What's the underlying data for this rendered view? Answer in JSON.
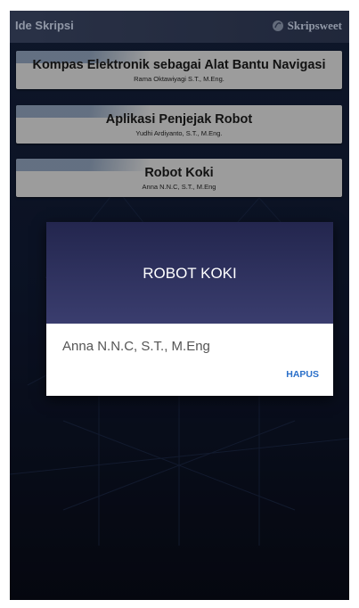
{
  "app_bar": {
    "title": "Ide Skripsi",
    "brand": "Skripsweet",
    "brand_icon": "skripsweet-logo-icon"
  },
  "cards": [
    {
      "title": "Kompas Elektronik sebagai Alat Bantu Navigasi",
      "subtitle": "Rama Oktawiyagi S.T., M.Eng."
    },
    {
      "title": "Aplikasi Penjejak Robot",
      "subtitle": "Yudhi Ardiyanto, S.T., M.Eng."
    },
    {
      "title": "Robot Koki",
      "subtitle": "Anna N.N.C, S.T., M.Eng"
    }
  ],
  "dialog": {
    "title": "ROBOT KOKI",
    "body": "Anna N.N.C, S.T., M.Eng",
    "button": "HAPUS"
  },
  "colors": {
    "app_bar": "#3a4562",
    "card_bg": "#d9d9d9",
    "dialog_header": "#2c2f5e",
    "accent_button": "#2a6fc9",
    "background": "#0c1020"
  }
}
